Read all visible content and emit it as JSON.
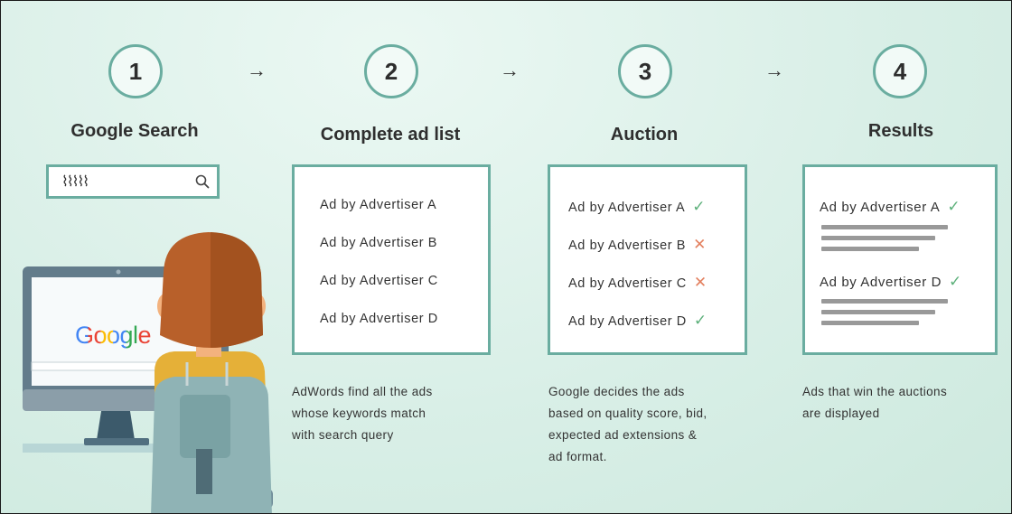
{
  "steps": [
    {
      "number": "1",
      "title": "Google Search"
    },
    {
      "number": "2",
      "title": "Complete ad list"
    },
    {
      "number": "3",
      "title": "Auction"
    },
    {
      "number": "4",
      "title": "Results"
    }
  ],
  "search": {
    "query_glyph": "⌇⌇⌇⌇⌇",
    "icon": "magnifier-icon"
  },
  "monitor": {
    "brand": "Google"
  },
  "ad_list": {
    "items": [
      "Ad by Advertiser A",
      "Ad by Advertiser B",
      "Ad by Advertiser C",
      "Ad by Advertiser D"
    ]
  },
  "auction": {
    "items": [
      {
        "label": "Ad by Advertiser A",
        "result": "✓",
        "status": "win"
      },
      {
        "label": "Ad by Advertiser B",
        "result": "✕",
        "status": "lose"
      },
      {
        "label": "Ad by Advertiser C",
        "result": "✕",
        "status": "lose"
      },
      {
        "label": "Ad by Advertiser D",
        "result": "✓",
        "status": "win"
      }
    ]
  },
  "results": {
    "items": [
      {
        "label": "Ad by Advertiser A",
        "mark": "✓"
      },
      {
        "label": "Ad by Advertiser D",
        "mark": "✓"
      }
    ]
  },
  "descriptions": {
    "ad_list": [
      "AdWords find all the ads",
      "whose keywords match",
      "with search query"
    ],
    "auction": [
      "Google decides the ads",
      "based on quality score, bid,",
      "expected ad extensions &",
      "ad format."
    ],
    "results": [
      "Ads that win the auctions",
      "are displayed"
    ]
  },
  "colors": {
    "accent": "#6aada0",
    "check": "#5cb07a",
    "cross": "#e3805f",
    "hair": "#b8602a",
    "skin": "#f3b27e",
    "shirt": "#e5b038",
    "hoodie": "#8fb3b5"
  },
  "arrow_glyph": "→"
}
